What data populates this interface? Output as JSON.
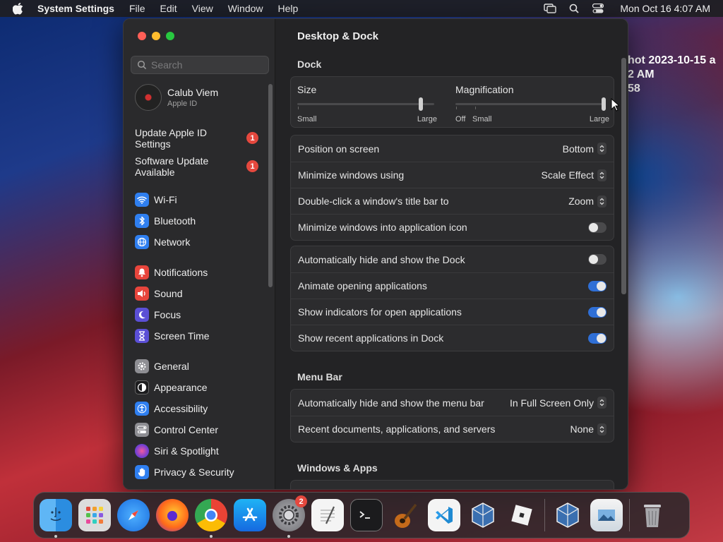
{
  "menubar": {
    "app_name": "System Settings",
    "items": [
      "File",
      "Edit",
      "View",
      "Window",
      "Help"
    ],
    "clock": "Mon Oct 16  4:07 AM"
  },
  "desktop_text": {
    "line1": "hot 2023-10-15 a",
    "line2": "2 AM",
    "line3": "58"
  },
  "sidebar": {
    "search_placeholder": "Search",
    "user": {
      "name": "Calub Viem",
      "sub": "Apple ID"
    },
    "notices": [
      {
        "label": "Update Apple ID Settings",
        "badge": "1"
      },
      {
        "label": "Software Update Available",
        "badge": "1"
      }
    ],
    "items": [
      {
        "label": "Wi-Fi",
        "icon": "wifi-icon",
        "color": "#2f7ff0"
      },
      {
        "label": "Bluetooth",
        "icon": "bluetooth-icon",
        "color": "#2f7ff0"
      },
      {
        "label": "Network",
        "icon": "globe-icon",
        "color": "#2f7ff0"
      },
      {
        "label": "Notifications",
        "icon": "bell-icon",
        "color": "#e8453c"
      },
      {
        "label": "Sound",
        "icon": "speaker-icon",
        "color": "#e8453c"
      },
      {
        "label": "Focus",
        "icon": "moon-icon",
        "color": "#5b4fd6"
      },
      {
        "label": "Screen Time",
        "icon": "hourglass-icon",
        "color": "#5b4fd6"
      },
      {
        "label": "General",
        "icon": "gear-icon",
        "color": "#8e8e93"
      },
      {
        "label": "Appearance",
        "icon": "appearance-icon",
        "color": "#1c1c1e"
      },
      {
        "label": "Accessibility",
        "icon": "accessibility-icon",
        "color": "#2f7ff0"
      },
      {
        "label": "Control Center",
        "icon": "control-center-icon",
        "color": "#8e8e93"
      },
      {
        "label": "Siri & Spotlight",
        "icon": "siri-icon",
        "color": "#7a3fd0"
      },
      {
        "label": "Privacy & Security",
        "icon": "hand-icon",
        "color": "#2f7ff0"
      }
    ]
  },
  "content": {
    "title": "Desktop & Dock",
    "dock_section": "Dock",
    "size": {
      "label": "Size",
      "min_label": "Small",
      "max_label": "Large",
      "value": 0.9
    },
    "magnification": {
      "label": "Magnification",
      "off_label": "Off",
      "min_label": "Small",
      "max_label": "Large",
      "value": 1.0
    },
    "popups": [
      {
        "label": "Position on screen",
        "value": "Bottom"
      },
      {
        "label": "Minimize windows using",
        "value": "Scale Effect"
      },
      {
        "label": "Double-click a window's title bar to",
        "value": "Zoom"
      }
    ],
    "minimize_into_icon": {
      "label": "Minimize windows into application icon",
      "on": false
    },
    "toggles": [
      {
        "label": "Automatically hide and show the Dock",
        "on": false
      },
      {
        "label": "Animate opening applications",
        "on": true
      },
      {
        "label": "Show indicators for open applications",
        "on": true
      },
      {
        "label": "Show recent applications in Dock",
        "on": true
      }
    ],
    "menubar_section": "Menu Bar",
    "menubar_rows": [
      {
        "label": "Automatically hide and show the menu bar",
        "value": "In Full Screen Only"
      },
      {
        "label": "Recent documents, applications, and servers",
        "value": "None"
      }
    ],
    "windows_section": "Windows & Apps"
  },
  "dock": {
    "items": [
      {
        "name": "finder-icon",
        "running": true
      },
      {
        "name": "launchpad-icon",
        "running": false
      },
      {
        "name": "safari-icon",
        "running": false
      },
      {
        "name": "firefox-icon",
        "running": false
      },
      {
        "name": "chrome-icon",
        "running": true
      },
      {
        "name": "app-store-icon",
        "running": false
      },
      {
        "name": "system-settings-icon",
        "running": true,
        "badge": "2"
      },
      {
        "name": "textedit-icon",
        "running": false
      },
      {
        "name": "terminal-icon",
        "running": false
      },
      {
        "name": "garageband-icon",
        "running": false
      },
      {
        "name": "vscode-icon",
        "running": false
      },
      {
        "name": "virtualbox-icon",
        "running": false
      },
      {
        "name": "roblox-icon",
        "running": false
      },
      {
        "name": "virtualbox-vm-icon",
        "running": false
      },
      {
        "name": "preview-icon",
        "running": false
      },
      {
        "name": "trash-icon",
        "running": false
      }
    ]
  }
}
